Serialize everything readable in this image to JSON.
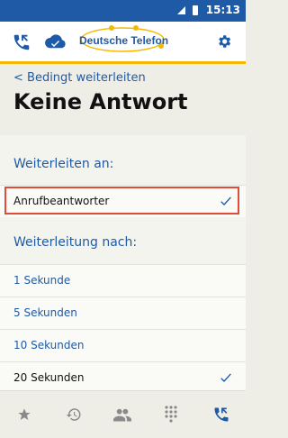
{
  "status": {
    "time": "15:13"
  },
  "brand": {
    "name": "Deutsche Telefon"
  },
  "nav": {
    "back": "< Bedingt weiterleiten",
    "title": "Keine Antwort"
  },
  "section1": {
    "label": "Weiterleiten an:",
    "items": [
      {
        "label": "Anrufbeantworter",
        "selected": true
      }
    ]
  },
  "section2": {
    "label": "Weiterleitung nach:",
    "items": [
      {
        "label": "1 Sekunde",
        "selected": false
      },
      {
        "label": "5 Sekunden",
        "selected": false
      },
      {
        "label": "10 Sekunden",
        "selected": false
      },
      {
        "label": "20 Sekunden",
        "selected": true
      }
    ]
  },
  "tabbar": {
    "items": [
      "star-icon",
      "history-icon",
      "contacts-icon",
      "dialpad-icon",
      "call-forward-icon"
    ],
    "active": "call-forward-icon"
  },
  "colors": {
    "primary": "#1f5aa6",
    "accent": "#f5b800",
    "highlight": "#e24a3a"
  }
}
